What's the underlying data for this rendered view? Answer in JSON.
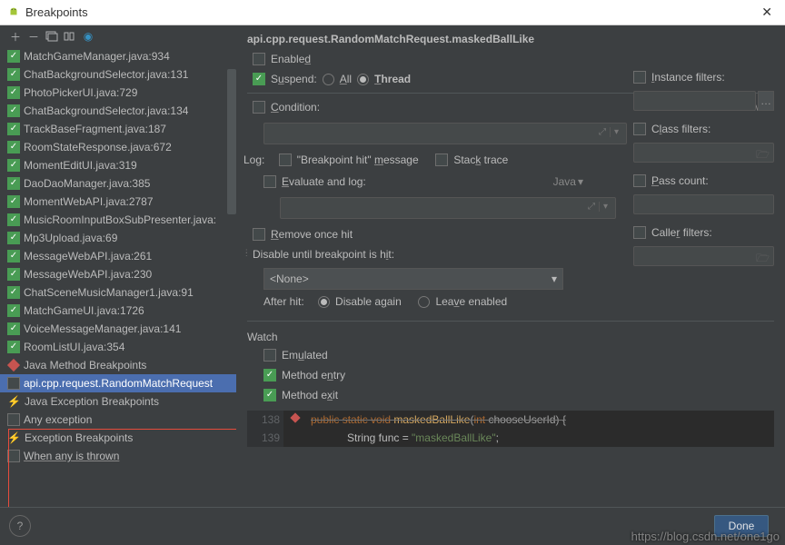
{
  "title": "Breakpoints",
  "breadcrumb": "api.cpp.request.RandomMatchRequest.maskedBallLike",
  "tree": [
    {
      "label": "MatchGameManager.java:934",
      "checked": true
    },
    {
      "label": "ChatBackgroundSelector.java:131",
      "checked": true
    },
    {
      "label": "PhotoPickerUI.java:729",
      "checked": true
    },
    {
      "label": "ChatBackgroundSelector.java:134",
      "checked": true
    },
    {
      "label": "TrackBaseFragment.java:187",
      "checked": true
    },
    {
      "label": "RoomStateResponse.java:672",
      "checked": true
    },
    {
      "label": "MomentEditUI.java:319",
      "checked": true
    },
    {
      "label": "DaoDaoManager.java:385",
      "checked": true
    },
    {
      "label": "MomentWebAPI.java:2787",
      "checked": true
    },
    {
      "label": "MusicRoomInputBoxSubPresenter.java:",
      "checked": true
    },
    {
      "label": "Mp3Upload.java:69",
      "checked": true
    },
    {
      "label": "MessageWebAPI.java:261",
      "checked": true
    },
    {
      "label": "MessageWebAPI.java:230",
      "checked": true
    },
    {
      "label": "ChatSceneMusicManager1.java:91",
      "checked": true
    },
    {
      "label": "MatchGameUI.java:1726",
      "checked": true
    },
    {
      "label": "VoiceMessageManager.java:141",
      "checked": true
    },
    {
      "label": "RoomListUI.java:354",
      "checked": true
    }
  ],
  "cat_java_method": "Java Method Breakpoints",
  "sel_item": "api.cpp.request.RandomMatchRequest",
  "cat_java_exc": "Java Exception Breakpoints",
  "any_exc": "Any exception",
  "cat_exc": "Exception Breakpoints",
  "when_thrown": "When any is thrown",
  "labels": {
    "enabled": "Enabled",
    "suspend": "Suspend:",
    "all": "All",
    "thread": "Thread",
    "condition": "Condition:",
    "java": "Java",
    "log": "Log:",
    "bphit": "\"Breakpoint hit\" message",
    "stack": "Stack trace",
    "evallog": "Evaluate and log:",
    "remove": "Remove once hit",
    "disable_until": "Disable until breakpoint is hit:",
    "none": "<None>",
    "after_hit": "After hit:",
    "disable_again": "Disable again",
    "leave": "Leave enabled",
    "instance": "Instance filters:",
    "class": "Class filters:",
    "pass": "Pass count:",
    "caller": "Caller filters:",
    "watch": "Watch",
    "emulated": "Emulated",
    "mentry": "Method entry",
    "mexit": "Method exit",
    "done": "Done"
  },
  "code": {
    "ln1": "138",
    "ln2": "139",
    "l1_pre": "public static void ",
    "l1_fn": "maskedBallLike",
    "l1_post": "(",
    "l1_typ": "int ",
    "l1_param": "chooseUserId",
    "l1_end": ") {",
    "l2_pre": "String func = ",
    "l2_str": "\"maskedBallLike\"",
    "l2_end": ";"
  },
  "watermark": "https://blog.csdn.net/one1go"
}
